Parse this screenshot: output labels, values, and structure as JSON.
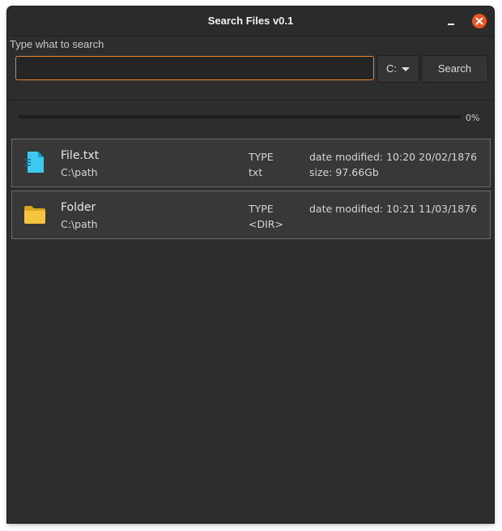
{
  "window": {
    "title": "Search Files v0.1"
  },
  "search": {
    "label": "Type what to search",
    "value": "",
    "placeholder": "",
    "drive": "C:",
    "button_label": "Search"
  },
  "progress": {
    "value": 0,
    "text": "0%"
  },
  "results": [
    {
      "icon": "text-file-icon",
      "name": "File.txt",
      "path": "C:\\path",
      "type_label": "TYPE",
      "type": "txt",
      "date": "date modified: 10:20 20/02/1876",
      "size": "size: 97.66Gb"
    },
    {
      "icon": "folder-icon",
      "name": "Folder",
      "path": "C:\\path",
      "type_label": "TYPE",
      "type": "<DIR>",
      "date": "date modified: 10:21 11/03/1876",
      "size": ""
    }
  ],
  "colors": {
    "accent": "#e95420",
    "focus_border": "#e8852e",
    "file_icon": "#3fc8f0",
    "folder_icon": "#f5c542"
  }
}
